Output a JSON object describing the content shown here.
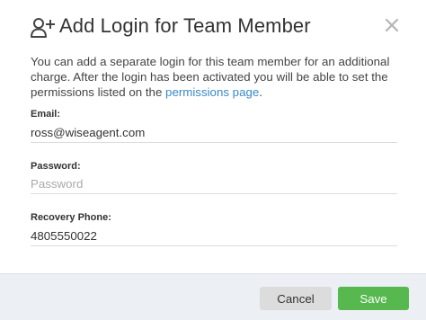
{
  "dialog": {
    "title": "Add Login for Team Member",
    "title_icon": "add-user-icon",
    "close_icon": "close-icon"
  },
  "description": {
    "text": "You can add a separate login for this team member for an additional charge. After the login has been activated you will be able to set the permissions listed on the",
    "link_text": "permissions page",
    "suffix": "."
  },
  "fields": {
    "email": {
      "label": "Email:",
      "value": "ross@wiseagent.com",
      "placeholder": ""
    },
    "password": {
      "label": "Password:",
      "value": "",
      "placeholder": "Password"
    },
    "recovery_phone": {
      "label": "Recovery Phone:",
      "value": "4805550022",
      "placeholder": ""
    }
  },
  "footer": {
    "cancel_label": "Cancel",
    "save_label": "Save"
  },
  "colors": {
    "link": "#3a88c8",
    "save_button": "#56b84e",
    "cancel_button": "#dcdcdc",
    "footer_bg": "#eceff3"
  }
}
